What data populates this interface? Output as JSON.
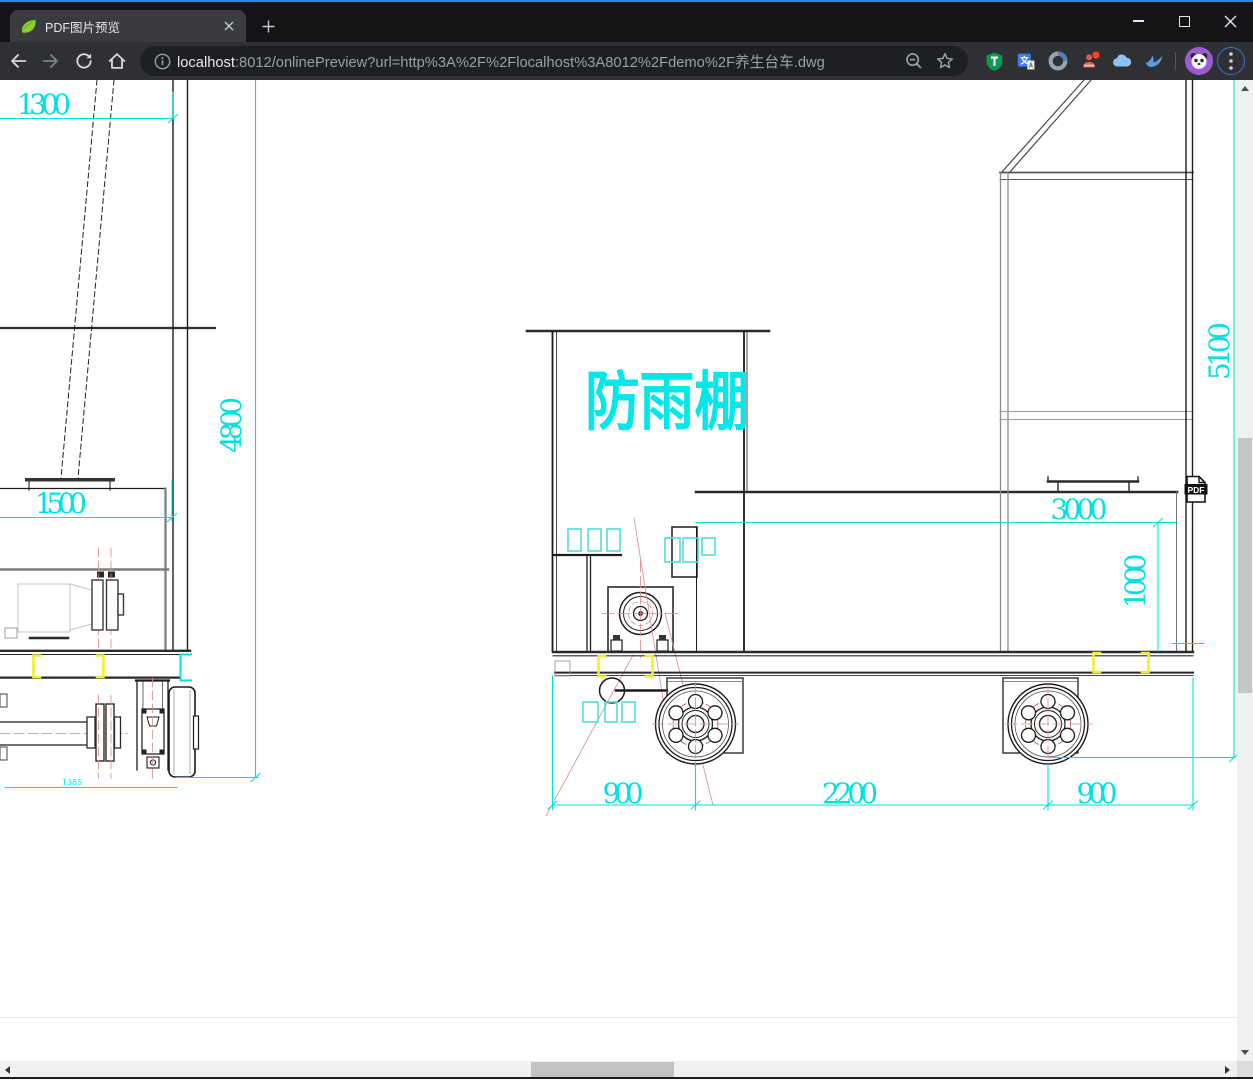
{
  "browser": {
    "tab_title": "PDF图片预览",
    "url_host": "localhost",
    "url_rest": ":8012/onlinePreview?url=http%3A%2F%2Flocalhost%3A8012%2Fdemo%2F养生台车.dwg"
  },
  "drawing": {
    "shelter_label": "防雨棚",
    "pdf_badge": "PDF",
    "dims": {
      "d1300": "1300",
      "d4800": "4800",
      "d1500": "1500",
      "d1385": "1385",
      "d3000": "3000",
      "d1000": "1000",
      "d5100": "5100",
      "d900_left": "900",
      "d2200": "2200",
      "d900_right": "900"
    },
    "colors": {
      "dimension_cyan": "#00e2e2",
      "highlight_yellow": "#f2ef2a",
      "centerline_red": "#cf6a6a",
      "line_dark": "#1c1c1c"
    }
  },
  "icons": [
    "spring-leaf-favicon",
    "tab-close-icon",
    "new-tab-plus-icon",
    "minimize-icon",
    "maximize-icon",
    "close-x-icon",
    "back-icon",
    "forward-icon",
    "reload-icon",
    "home-icon",
    "info-icon",
    "zoom-icon",
    "bookmark-star-icon",
    "shield-t-icon",
    "translate-icon",
    "ring-icon",
    "people-icon",
    "cloud-icon",
    "bird-icon",
    "panda-avatar-icon",
    "kebab-menu-icon",
    "pdf-badge",
    "scroll-up-arrow",
    "scroll-down-arrow",
    "scroll-left-arrow",
    "scroll-right-arrow"
  ]
}
